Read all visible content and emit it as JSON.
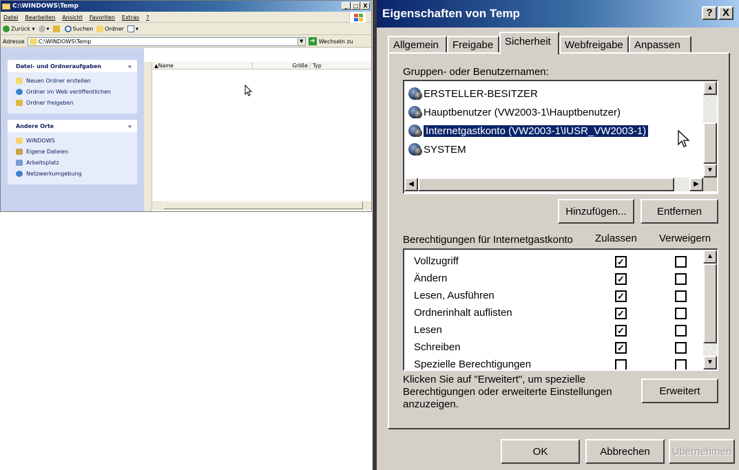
{
  "explorer": {
    "title": "C:\\WINDOWS\\Temp",
    "window_buttons": [
      "_",
      "□",
      "X"
    ],
    "menu": [
      "Datei",
      "Bearbeiten",
      "Ansicht",
      "Favoriten",
      "Extras",
      "?"
    ],
    "toolbar": {
      "back": "Zurück",
      "search": "Suchen",
      "folders": "Ordner"
    },
    "address": {
      "label": "Adresse",
      "value": "C:\\WINDOWS\\Temp",
      "go": "Wechseln zu"
    },
    "tasks": {
      "header": "Datei- und Ordneraufgaben",
      "items": [
        "Neuen Ordner erstellen",
        "Ordner im Web veröffentlichen",
        "Ordner freigeben"
      ]
    },
    "places": {
      "header": "Andere Orte",
      "items": [
        "WINDOWS",
        "Eigene Dateien",
        "Arbeitsplatz",
        "Netzwerkumgebung"
      ]
    },
    "columns": [
      "Name",
      "Größe",
      "Typ"
    ]
  },
  "dialog": {
    "title": "Eigenschaften von Temp",
    "title_buttons": [
      "?",
      "X"
    ],
    "tabs": [
      "Allgemein",
      "Freigabe",
      "Sicherheit",
      "Webfreigabe",
      "Anpassen"
    ],
    "active_tab": "Sicherheit",
    "groups_label": "Gruppen- oder Benutzernamen:",
    "users": [
      "ERSTELLER-BESITZER",
      "Hauptbenutzer (VW2003-1\\Hauptbenutzer)",
      "Internetgastkonto (VW2003-1\\IUSR_VW2003-1)",
      "SYSTEM"
    ],
    "selected_user": "Internetgastkonto (VW2003-1\\IUSR_VW2003-1)",
    "add_button": "Hinzufügen...",
    "remove_button": "Entfernen",
    "permissions_label": "Berechtigungen für Internetgastkonto",
    "allow_header": "Zulassen",
    "deny_header": "Verweigern",
    "permissions": [
      {
        "name": "Vollzugriff",
        "allow": true,
        "deny": false
      },
      {
        "name": "Ändern",
        "allow": true,
        "deny": false
      },
      {
        "name": "Lesen, Ausführen",
        "allow": true,
        "deny": false
      },
      {
        "name": "Ordnerinhalt auflisten",
        "allow": true,
        "deny": false
      },
      {
        "name": "Lesen",
        "allow": true,
        "deny": false
      },
      {
        "name": "Schreiben",
        "allow": true,
        "deny": false
      },
      {
        "name": "Spezielle Berechtigungen",
        "allow": false,
        "deny": false
      }
    ],
    "advanced_text": "Klicken Sie auf \"Erweitert\", um spezielle Berechtigungen oder erweiterte Einstellungen anzuzeigen.",
    "advanced_lines": [
      "Klicken Sie auf \"Erweitert\", um spezielle",
      "Berechtigungen oder erweiterte Einstellungen",
      "anzuzeigen."
    ],
    "advanced_button": "Erweitert",
    "ok_button": "OK",
    "cancel_button": "Abbrechen",
    "apply_button": "Übernehmen"
  },
  "colors": {
    "title_gradient_start": "#0a246a",
    "title_gradient_end": "#a6caf0",
    "dialog_face": "#d4d0c8",
    "selection": "#0a246a"
  }
}
